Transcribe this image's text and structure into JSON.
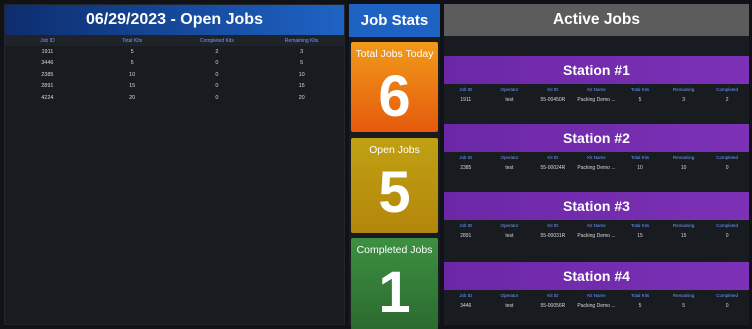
{
  "open_jobs": {
    "title": "06/29/2023 - Open Jobs",
    "columns": [
      "Job ID",
      "Total Kits",
      "Completed Kits",
      "Remaining Kits"
    ],
    "rows": [
      [
        "1911",
        "5",
        "2",
        "3"
      ],
      [
        "3446",
        "5",
        "0",
        "5"
      ],
      [
        "2385",
        "10",
        "0",
        "10"
      ],
      [
        "2891",
        "15",
        "0",
        "15"
      ],
      [
        "4224",
        "20",
        "0",
        "20"
      ]
    ]
  },
  "job_stats": {
    "title": "Job Stats",
    "total_label": "Total Jobs Today",
    "total_value": "6",
    "open_label": "Open Jobs",
    "open_value": "5",
    "completed_label": "Completed Jobs",
    "completed_value": "1"
  },
  "active_jobs": {
    "title": "Active Jobs",
    "columns": [
      "Job ID",
      "Operator",
      "Kit ID",
      "Kit Name",
      "Total Kits",
      "Remaining",
      "Completed"
    ],
    "stations": [
      {
        "name": "Station #1",
        "row": [
          "1911",
          "test",
          "55-00450R",
          "Packing Demo ...",
          "5",
          "3",
          "2"
        ]
      },
      {
        "name": "Station #2",
        "row": [
          "2385",
          "test",
          "55-00024R",
          "Packing Demo ...",
          "10",
          "10",
          "0"
        ]
      },
      {
        "name": "Station #3",
        "row": [
          "2891",
          "test",
          "55-00031R",
          "Packing Demo ...",
          "15",
          "15",
          "0"
        ]
      },
      {
        "name": "Station #4",
        "row": [
          "3446",
          "test",
          "55-00056R",
          "Packing Demo ...",
          "5",
          "5",
          "0"
        ]
      }
    ]
  }
}
